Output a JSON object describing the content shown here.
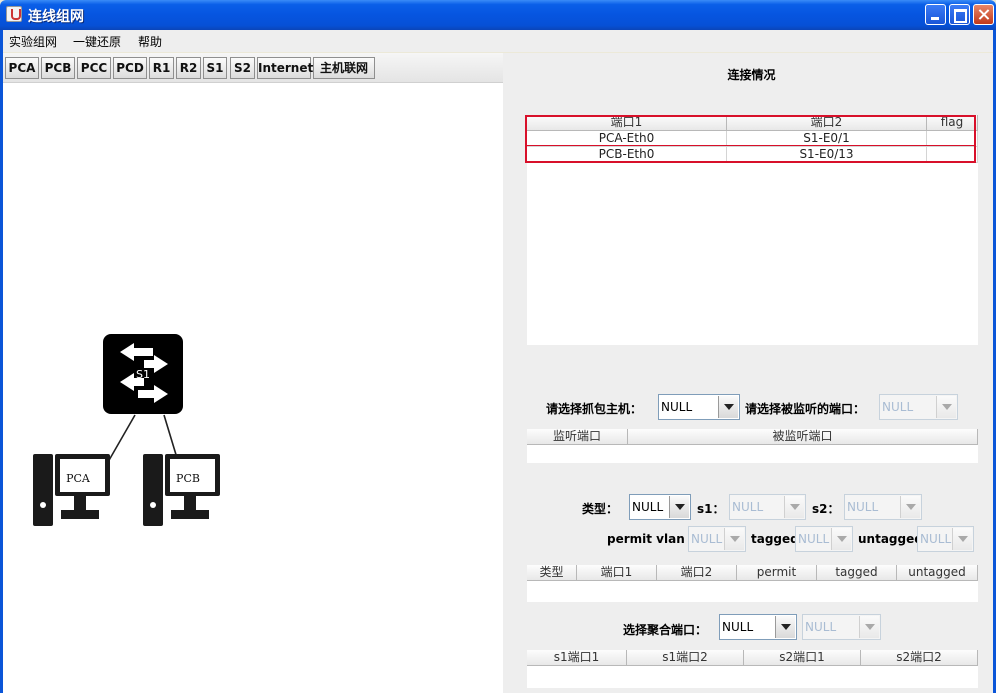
{
  "window": {
    "title": "连线组网"
  },
  "menu": [
    "实验组网",
    "一键还原",
    "帮助"
  ],
  "toolbar": {
    "buttons": [
      "PCA",
      "PCB",
      "PCC",
      "PCD",
      "R1",
      "R2",
      "S1",
      "S2",
      "Internet",
      "主机联网"
    ]
  },
  "topology": {
    "switch": {
      "label": "S1",
      "icon": "switch-icon"
    },
    "hosts": [
      {
        "label": "PCA",
        "icon": "computer-icon"
      },
      {
        "label": "PCB",
        "icon": "computer-icon"
      }
    ]
  },
  "connections": {
    "title": "连接情况",
    "columns": [
      "端口1",
      "端口2",
      "flag"
    ],
    "rows": [
      [
        "PCA-Eth0",
        "S1-E0/1",
        ""
      ],
      [
        "PCB-Eth0",
        "S1-E0/13",
        ""
      ]
    ],
    "highlight_color": "#d8102a"
  },
  "capture": {
    "host_label": "请选择抓包主机：",
    "host_value": "NULL",
    "port_label": "请选择被监听的端口：",
    "port_value": "NULL",
    "columns": [
      "监听端口",
      "被监听端口"
    ]
  },
  "vlan": {
    "type_label": "类型：",
    "type_value": "NULL",
    "s1_label": "s1：",
    "s1_value": "NULL",
    "s2_label": "s2：",
    "s2_value": "NULL",
    "permit_label": "permit vlan id",
    "permit_value": "NULL",
    "tagged_label": "tagged",
    "tagged_value": "NULL",
    "untagged_label": "untagged",
    "untagged_value": "NULL",
    "columns": [
      "类型",
      "端口1",
      "端口2",
      "permit",
      "tagged",
      "untagged"
    ]
  },
  "aggregation": {
    "label": "选择聚合端口：",
    "value1": "NULL",
    "value2": "NULL",
    "columns": [
      "s1端口1",
      "s1端口2",
      "s2端口1",
      "s2端口2"
    ]
  }
}
